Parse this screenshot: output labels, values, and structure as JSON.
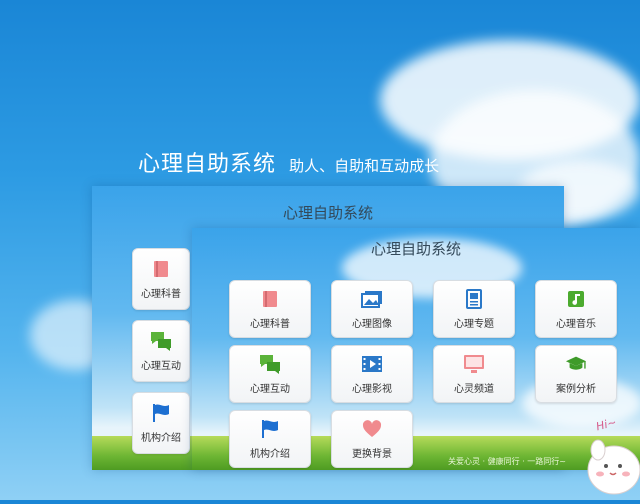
{
  "hero": {
    "title": "心理自助系统",
    "subtitle": "助人、自助和互动成长"
  },
  "back_panel": {
    "title": "心理自助系统",
    "tiles": [
      {
        "label": "心理科普",
        "icon": "book-icon",
        "color": "#f08a8e"
      },
      {
        "label": "心理互动",
        "icon": "chat-icon",
        "color": "#5bb33a"
      },
      {
        "label": "机构介绍",
        "icon": "flag-icon",
        "color": "#1d6fd1"
      }
    ]
  },
  "front_panel": {
    "title": "心理自助系统",
    "tiles": [
      {
        "label": "心理科普",
        "icon": "book-icon",
        "color": "#f08a8e"
      },
      {
        "label": "心理图像",
        "icon": "images-icon",
        "color": "#2a78c8"
      },
      {
        "label": "心理专题",
        "icon": "document-icon",
        "color": "#2a78c8"
      },
      {
        "label": "心理音乐",
        "icon": "music-icon",
        "color": "#4cab2f"
      },
      {
        "label": "心理互动",
        "icon": "chat-icon",
        "color": "#5bb33a"
      },
      {
        "label": "心理影视",
        "icon": "film-icon",
        "color": "#2a78c8"
      },
      {
        "label": "心灵频道",
        "icon": "monitor-icon",
        "color": "#f08a8e"
      },
      {
        "label": "案例分析",
        "icon": "graduation-cap-icon",
        "color": "#3f9b2a"
      },
      {
        "label": "机构介绍",
        "icon": "flag-icon",
        "color": "#1d6fd1"
      },
      {
        "label": "更换背景",
        "icon": "heart-icon",
        "color": "#f08a8e"
      }
    ],
    "banner_text": "关爱心灵 · 健康同行 · 一路同行~",
    "mascot_text": "Hi~"
  }
}
